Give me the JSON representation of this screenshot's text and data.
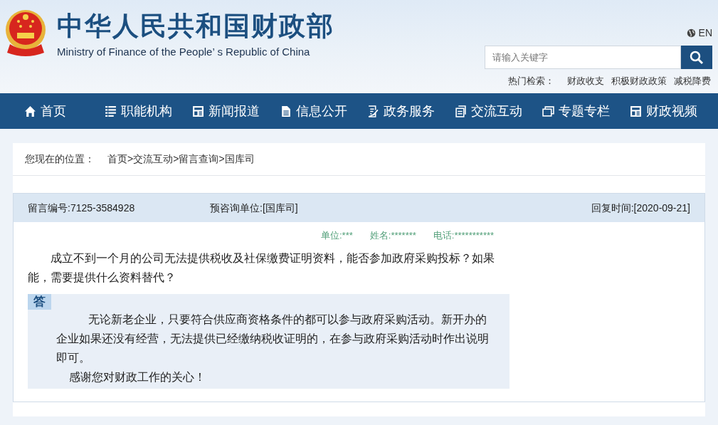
{
  "header": {
    "title": "中华人民共和国财政部",
    "subtitle": "Ministry of Finance of the People’ s Republic of China",
    "language": "EN",
    "search": {
      "placeholder": "请输入关键字"
    },
    "hot_label": "热门检索：",
    "hot_links": [
      "财政收支",
      "积极财政政策",
      "减税降费"
    ]
  },
  "nav": [
    {
      "label": "首页",
      "kind": "home"
    },
    {
      "label": "职能机构",
      "kind": "list"
    },
    {
      "label": "新闻报道",
      "kind": "news"
    },
    {
      "label": "信息公开",
      "kind": "doc"
    },
    {
      "label": "政务服务",
      "kind": "edit"
    },
    {
      "label": "交流互动",
      "kind": "copy"
    },
    {
      "label": "专题专栏",
      "kind": "window"
    },
    {
      "label": "财政视频",
      "kind": "news"
    }
  ],
  "breadcrumb": {
    "label": "您现在的位置：",
    "items": [
      "首页",
      "交流互动",
      "留言查询",
      "国库司"
    ],
    "separator": ">"
  },
  "message": {
    "number": "留言编号:7125-3584928",
    "unit": "预咨询单位:[国库司]",
    "reply_time": "回复时间:[2020-09-21]",
    "meta": [
      "单位:***",
      "姓名:*******",
      "电话:***********"
    ],
    "question": "成立不到一个月的公司无法提供税收及社保缴费证明资料，能否参加政府采购投标？如果能，需要提供什么资料替代？",
    "answer_tag": "答",
    "answer": "无论新老企业，只要符合供应商资格条件的都可以参与政府采购活动。新开办的企业如果还没有经营，无法提供已经缴纳税收证明的，在参与政府采购活动时作出说明即可。",
    "thanks": "感谢您对财政工作的关心！"
  }
}
